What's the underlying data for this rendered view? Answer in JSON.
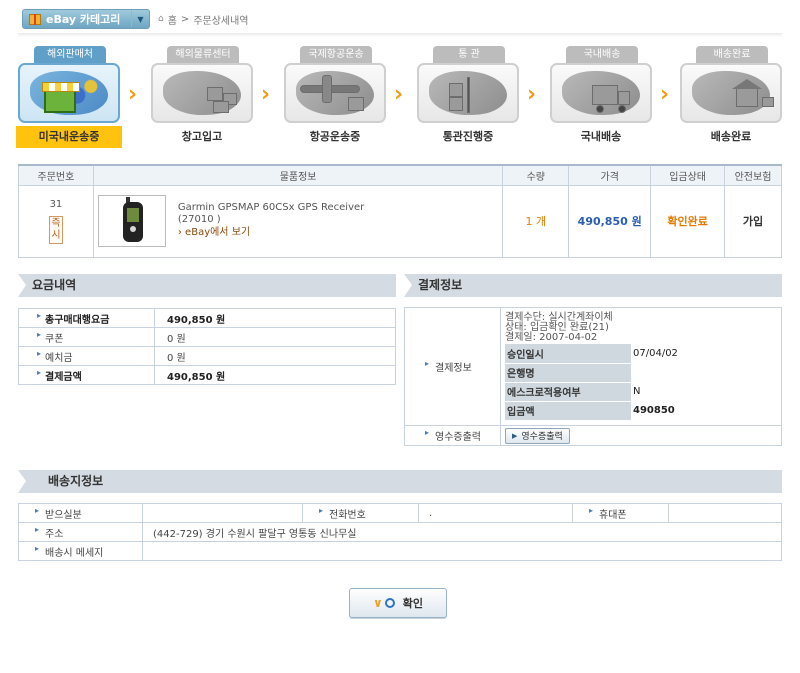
{
  "top": {
    "category_button": "eBay 카테고리",
    "breadcrumb": [
      "홈",
      ">",
      "주문상세내역"
    ]
  },
  "steps": [
    {
      "tab": "해외판매처",
      "caption": "미국내운송중",
      "active": true,
      "icon": "us-map-shop-icon"
    },
    {
      "tab": "해외물류센터",
      "caption": "창고입고",
      "active": false,
      "icon": "warehouse-boxes-icon"
    },
    {
      "tab": "국제항공운송",
      "caption": "항공운송중",
      "active": false,
      "icon": "airplane-cargo-icon"
    },
    {
      "tab": "통 관",
      "caption": "통관진행중",
      "active": false,
      "icon": "customs-hand-truck-icon"
    },
    {
      "tab": "국내배송",
      "caption": "국내배송",
      "active": false,
      "icon": "delivery-truck-icon"
    },
    {
      "tab": "배송완료",
      "caption": "배송완료",
      "active": false,
      "icon": "house-delivered-icon"
    }
  ],
  "orders": {
    "headers": [
      "주문번호",
      "물품정보",
      "수량",
      "가격",
      "입금상태",
      "안전보험"
    ],
    "row": {
      "order_no": "31",
      "instant_button": "즉시",
      "product_name": "Garmin GPSMAP 60CSx GPS Receiver",
      "product_code": "(27010          )",
      "ebay_link": "› eBay에서 보기",
      "qty": "1 개",
      "price": "490,850 원",
      "payment_status": "확인완료",
      "insurance": "가입"
    }
  },
  "fees": {
    "title": "요금내역",
    "rows": [
      {
        "label": "총구매대행요금",
        "value": "490,850 원",
        "bold": true
      },
      {
        "label": "쿠폰",
        "value": "0 원",
        "bold": false
      },
      {
        "label": "예치금",
        "value": "0 원",
        "bold": false
      },
      {
        "label": "결제금액",
        "value": "490,850 원",
        "bold": true
      }
    ]
  },
  "payment": {
    "title": "결제정보",
    "label": "결제정보",
    "lines": [
      "결제수단: 실시간계좌이체",
      "상태: 입금확인 완료(21)",
      "결제일: 2007-04-02"
    ],
    "details": [
      {
        "k": "승인일시",
        "v": "07/04/02"
      },
      {
        "k": "은행명",
        "v": ""
      },
      {
        "k": "에스크로적용여부",
        "v": "N"
      },
      {
        "k": "입금액",
        "v": "490850"
      }
    ],
    "receipt_label": "영수증출력",
    "receipt_button": "영수증출력"
  },
  "delivery": {
    "title": "배송지정보",
    "receiver_label": "받으실분",
    "receiver": "",
    "phone_label": "전화번호",
    "phone": ".",
    "mobile_label": "휴대폰",
    "mobile": "",
    "address_label": "주소",
    "address": "(442-729) 경기 수원시 팔달구 영통동 신나무실",
    "message_label": "배송시 메세지",
    "message": ""
  },
  "confirm_button": "확인"
}
